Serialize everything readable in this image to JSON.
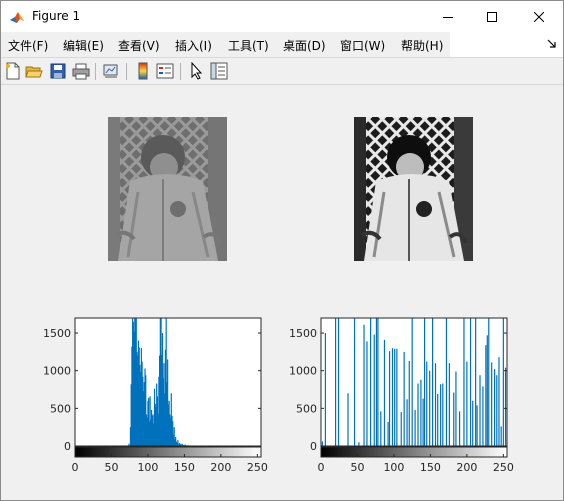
{
  "window": {
    "title": "Figure 1"
  },
  "menu": {
    "items": [
      "文件(F)",
      "编辑(E)",
      "查看(V)",
      "插入(I)",
      "工具(T)",
      "桌面(D)",
      "窗口(W)",
      "帮助(H)"
    ]
  },
  "toolbar": {
    "icons": [
      "new-figure-icon",
      "open-file-icon",
      "save-icon",
      "print-icon",
      "link-plot-icon",
      "insert-colorbar-icon",
      "insert-legend-icon",
      "edit-plot-icon",
      "property-inspector-icon"
    ]
  },
  "colors": {
    "bar": "#0072bd",
    "axes_bg": "#ffffff",
    "figure_bg": "#f0f0f0"
  },
  "images": [
    {
      "name": "original-image",
      "tone": "low-contrast"
    },
    {
      "name": "equalized-image",
      "tone": "high-contrast"
    }
  ],
  "chart_data": [
    {
      "type": "bar",
      "subplot": "bottom-left",
      "xlim": [
        0,
        255
      ],
      "ylim": [
        0,
        1700
      ],
      "xticks": [
        0,
        50,
        100,
        150,
        200,
        250
      ],
      "yticks": [
        0,
        500,
        1000,
        1500
      ],
      "colorbar": "grayscale",
      "x": [
        74,
        76,
        77,
        78,
        79,
        80,
        81,
        82,
        83,
        84,
        85,
        86,
        87,
        88,
        89,
        90,
        91,
        92,
        93,
        94,
        95,
        96,
        97,
        98,
        99,
        100,
        101,
        102,
        103,
        104,
        105,
        106,
        107,
        108,
        109,
        110,
        111,
        112,
        113,
        114,
        115,
        116,
        117,
        118,
        119,
        120,
        121,
        122,
        123,
        124,
        125,
        126,
        127,
        128,
        129,
        130,
        131,
        132,
        133,
        134,
        135,
        136,
        137,
        138,
        139,
        140,
        141,
        142,
        143,
        144,
        145,
        146,
        147,
        148,
        149,
        150,
        151,
        152,
        153,
        154,
        155,
        156,
        157,
        158,
        159,
        160,
        161,
        162,
        163,
        164,
        165,
        166,
        167,
        168,
        169,
        170
      ],
      "values": [
        30,
        250,
        820,
        1320,
        1700,
        1650,
        1520,
        1700,
        1700,
        1700,
        1250,
        1200,
        1400,
        1310,
        1080,
        980,
        1300,
        1120,
        920,
        730,
        850,
        1030,
        940,
        420,
        380,
        600,
        640,
        320,
        660,
        350,
        480,
        400,
        420,
        300,
        760,
        560,
        520,
        830,
        660,
        430,
        920,
        1200,
        1700,
        1700,
        1210,
        1500,
        900,
        1100,
        700,
        1280,
        1700,
        850,
        1150,
        550,
        600,
        420,
        380,
        700,
        400,
        330,
        150,
        250,
        90,
        120,
        60,
        40,
        80,
        20,
        40,
        15,
        30,
        10,
        30,
        8,
        12,
        5,
        20,
        5,
        8,
        4,
        10,
        3,
        5,
        2,
        4,
        2,
        3,
        2,
        3,
        1,
        2,
        1,
        2,
        1,
        1,
        1
      ]
    },
    {
      "type": "bar",
      "subplot": "bottom-right",
      "xlim": [
        0,
        255
      ],
      "ylim": [
        0,
        1700
      ],
      "xticks": [
        0,
        50,
        100,
        150,
        200,
        250
      ],
      "yticks": [
        0,
        500,
        1000,
        1500
      ],
      "colorbar": "grayscale",
      "x": [
        2,
        6,
        20,
        24,
        37,
        46,
        52,
        59,
        63,
        68,
        73,
        76,
        78,
        82,
        87,
        92,
        94,
        98,
        101,
        104,
        110,
        114,
        118,
        121,
        125,
        129,
        133,
        137,
        140,
        142,
        145,
        149,
        153,
        157,
        160,
        164,
        167,
        172,
        176,
        182,
        185,
        190,
        196,
        200,
        205,
        208,
        212,
        214,
        218,
        222,
        226,
        228,
        230,
        234,
        238,
        241,
        244,
        247,
        250,
        253
      ],
      "values": [
        60,
        1500,
        1700,
        1700,
        700,
        1700,
        50,
        1610,
        1390,
        1700,
        1480,
        1700,
        1700,
        460,
        1410,
        320,
        1260,
        1300,
        1290,
        1290,
        450,
        1250,
        620,
        1130,
        1700,
        480,
        830,
        880,
        630,
        1700,
        1120,
        1000,
        1700,
        1100,
        690,
        820,
        830,
        1700,
        1100,
        710,
        990,
        460,
        1700,
        1120,
        1700,
        600,
        1700,
        540,
        940,
        790,
        1340,
        1470,
        1700,
        1110,
        1020,
        940,
        1180,
        260,
        1700,
        1040
      ]
    }
  ]
}
